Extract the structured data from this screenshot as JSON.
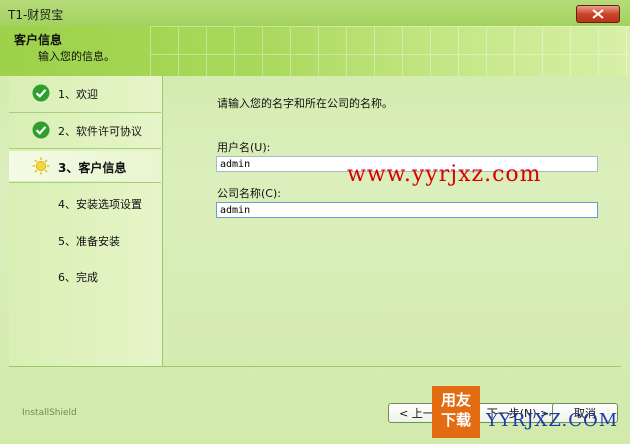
{
  "window": {
    "title": "T1-财贸宝"
  },
  "header": {
    "title": "客户信息",
    "subtitle": "输入您的信息。"
  },
  "steps": [
    {
      "label": "1、欢迎",
      "state": "done"
    },
    {
      "label": "2、软件许可协议",
      "state": "done"
    },
    {
      "label": "3、客户信息",
      "state": "current"
    },
    {
      "label": "4、安装选项设置",
      "state": "pending"
    },
    {
      "label": "5、准备安装",
      "state": "pending"
    },
    {
      "label": "6、完成",
      "state": "pending"
    }
  ],
  "main": {
    "prompt": "请输入您的名字和所在公司的名称。",
    "username_label": "用户名(U):",
    "username_value": "admin",
    "company_label": "公司名称(C):",
    "company_value": "admin"
  },
  "watermark": {
    "url": "www.yyrjxz.com"
  },
  "footer": {
    "brand": "InstallShield",
    "back_label": "< 上一步(B)",
    "next_label": "下一步(N) >",
    "cancel_label": "取消",
    "logo_text": "YYRJXZ.COM",
    "logo_glyphs": "用友下载"
  },
  "colors": {
    "accent_green": "#9ed24a",
    "check_green": "#2e9e2e",
    "watermark_red": "#d80000"
  }
}
